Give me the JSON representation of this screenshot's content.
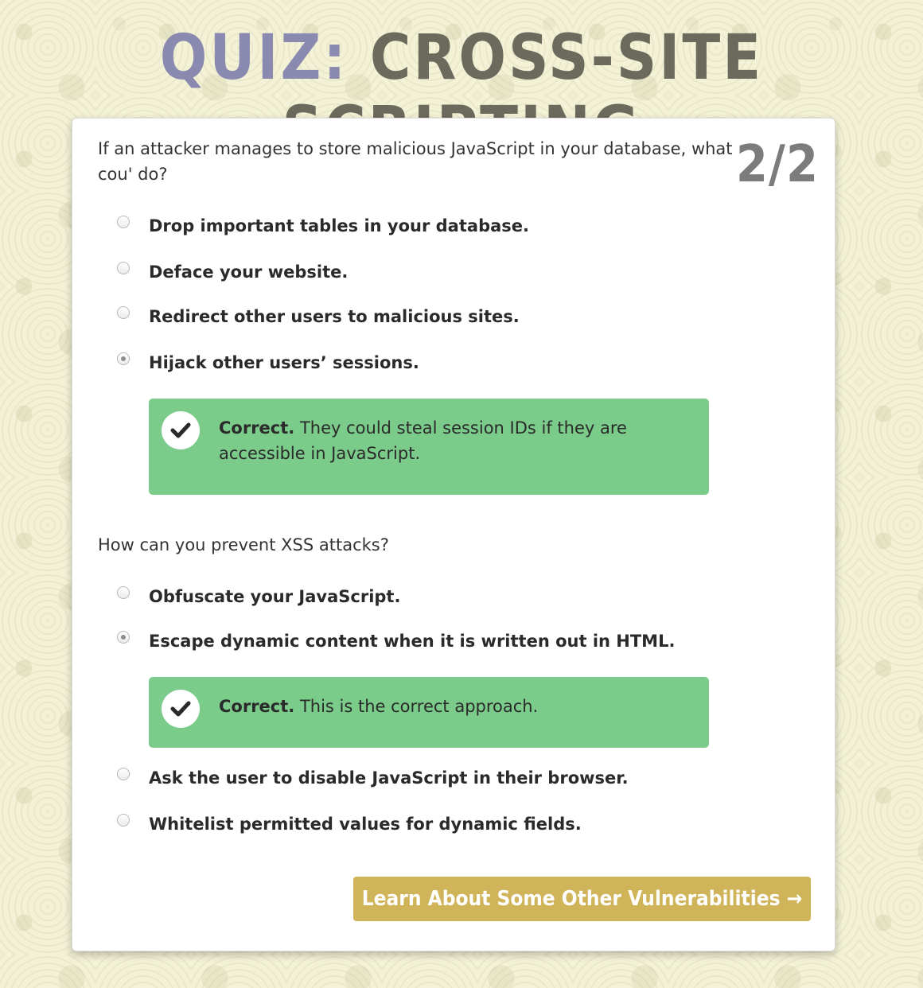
{
  "header": {
    "title_prefix": "QUIZ:",
    "title_main": "CROSS-SITE SCRIPTING"
  },
  "quiz": {
    "counter": "2/2",
    "questions": [
      {
        "text": "If an attacker manages to store malicious JavaScript in your database, what cou' do?",
        "options": [
          {
            "label": "Drop important tables in your database.",
            "selected": false
          },
          {
            "label": "Deface your website.",
            "selected": false
          },
          {
            "label": "Redirect other users to malicious sites.",
            "selected": false
          },
          {
            "label": "Hijack other users’ sessions.",
            "selected": true
          }
        ],
        "feedback": {
          "strong": "Correct.",
          "text": "They could steal session IDs if they are accessible in JavaScript."
        }
      },
      {
        "text": "How can you prevent XSS attacks?",
        "options": [
          {
            "label": "Obfuscate your JavaScript.",
            "selected": false
          },
          {
            "label": "Escape dynamic content when it is written out in HTML.",
            "selected": true
          },
          {
            "label": "Ask the user to disable JavaScript in their browser.",
            "selected": false
          },
          {
            "label": "Whitelist permitted values for dynamic fields.",
            "selected": false
          }
        ],
        "feedback": {
          "strong": "Correct.",
          "text": "This is the correct approach."
        }
      }
    ],
    "next_button_label": "Learn About Some Other Vulnerabilities →"
  },
  "colors": {
    "title_prefix": "#8a8ab0",
    "title_main": "#6b6a5c",
    "feedback_correct": "#7bcb8a",
    "button": "#cfb45a"
  },
  "icons": {
    "feedback": "checkmark-icon"
  }
}
